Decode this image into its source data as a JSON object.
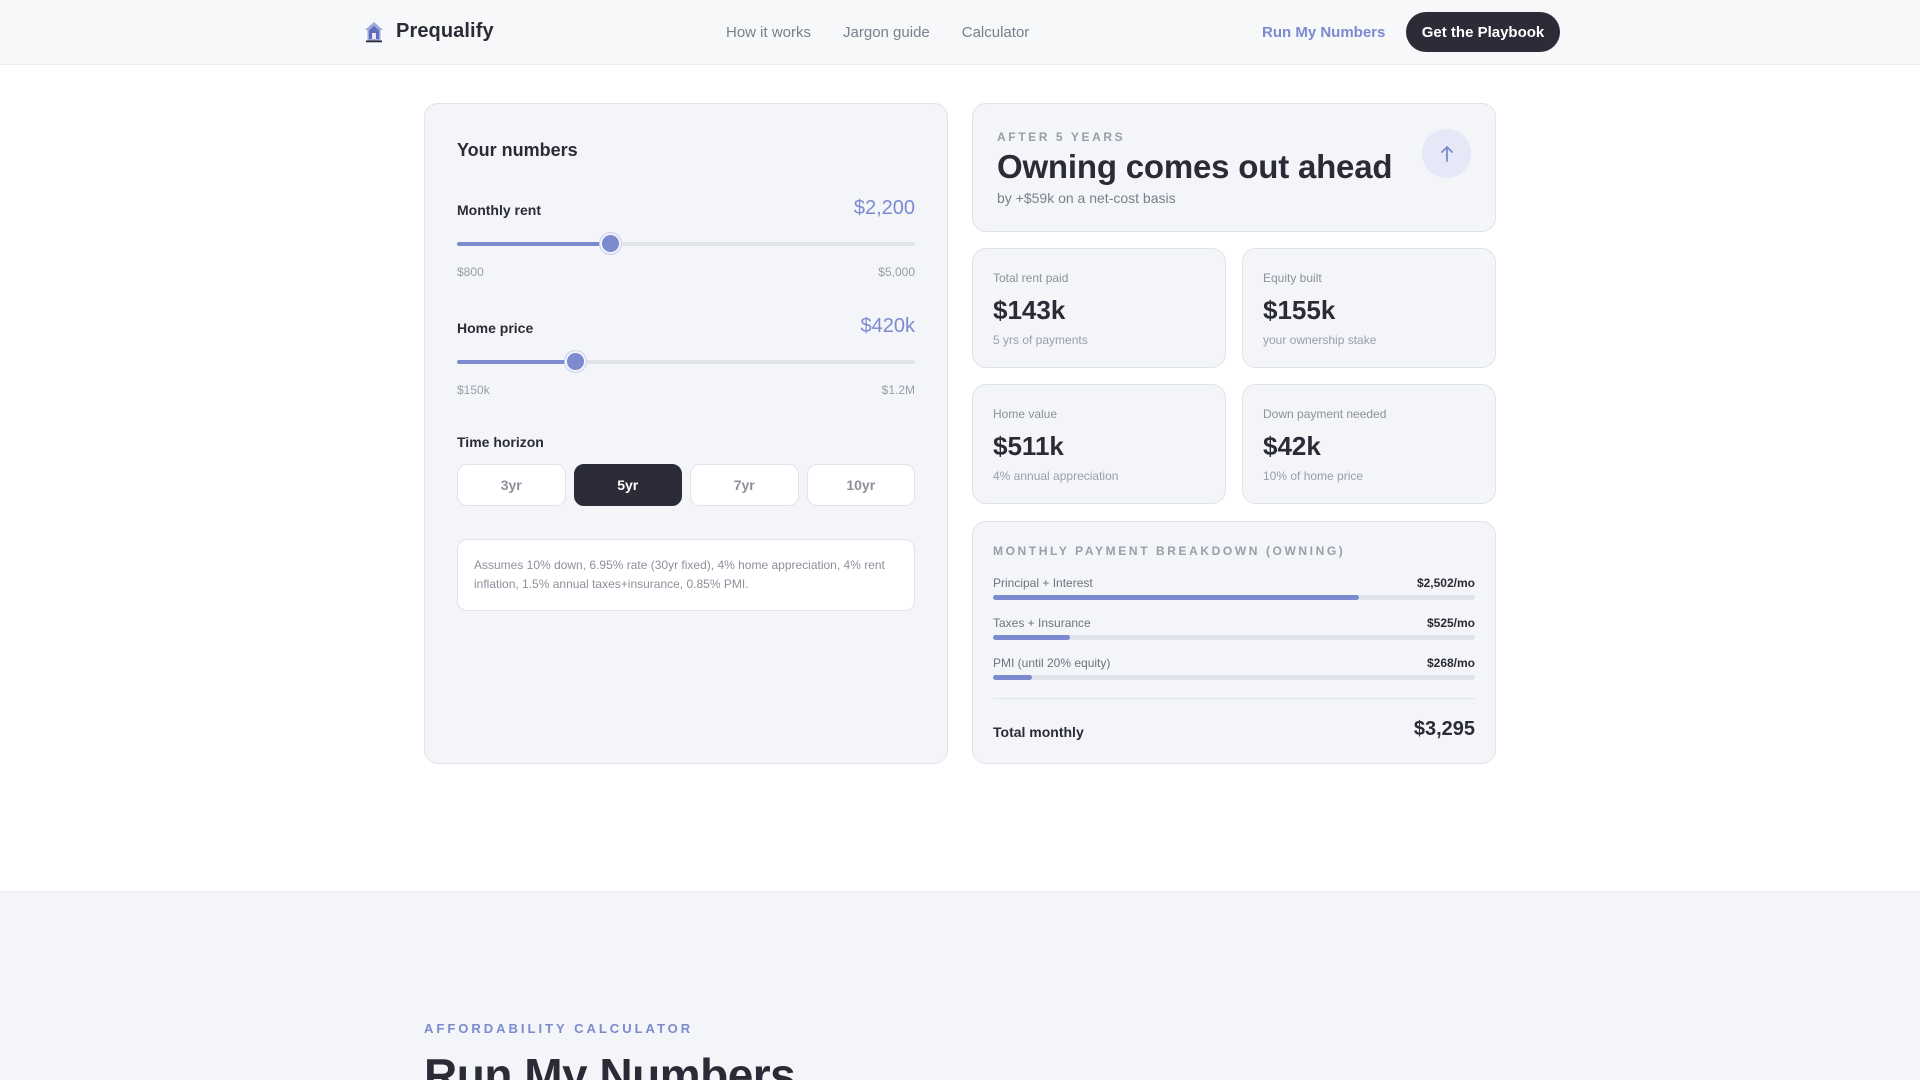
{
  "nav": {
    "brand": "Prequalify",
    "links": [
      "How it works",
      "Jargon guide",
      "Calculator"
    ],
    "cta_link": "Run My Numbers",
    "cta_button": "Get the Playbook"
  },
  "inputs": {
    "title": "Your numbers",
    "rent": {
      "label": "Monthly rent",
      "value": "$2,200",
      "min": "$800",
      "max": "$5,000",
      "position": 0.3333
    },
    "price": {
      "label": "Home price",
      "value": "$420k",
      "min": "$150k",
      "max": "$1.2M",
      "position": 0.2571
    },
    "horizon": {
      "label": "Time horizon",
      "options": [
        "3yr",
        "5yr",
        "7yr",
        "10yr"
      ],
      "selected": "5yr"
    },
    "assumptions": "Assumes 10% down, 6.95% rate (30yr fixed), 4% home appreciation, 4% rent inflation, 1.5% annual taxes+insurance, 0.85% PMI."
  },
  "result": {
    "eyebrow": "AFTER 5 YEARS",
    "headline": "Owning comes out ahead",
    "sub": "by +$59k on a net-cost basis",
    "icon": "arrow-up-icon"
  },
  "stats": [
    {
      "label": "Total rent paid",
      "value": "$143k",
      "note": "5 yrs of payments"
    },
    {
      "label": "Equity built",
      "value": "$155k",
      "note": "your ownership stake"
    },
    {
      "label": "Home value",
      "value": "$511k",
      "note": "4% annual appreciation"
    },
    {
      "label": "Down payment needed",
      "value": "$42k",
      "note": "10% of home price"
    }
  ],
  "breakdown": {
    "title": "MONTHLY PAYMENT BREAKDOWN (OWNING)",
    "rows": [
      {
        "label": "Principal + Interest",
        "amount": "$2,502/mo",
        "share": 0.76
      },
      {
        "label": "Taxes + Insurance",
        "amount": "$525/mo",
        "share": 0.16
      },
      {
        "label": "PMI (until 20% equity)",
        "amount": "$268/mo",
        "share": 0.08
      }
    ],
    "total_label": "Total monthly",
    "total_value": "$3,295"
  },
  "section2": {
    "eyebrow": "AFFORDABILITY CALCULATOR",
    "title": "Run My Numbers"
  },
  "colors": {
    "accent": "#7c8ad0",
    "dark": "#2b2c37",
    "card": "#f4f5f9"
  }
}
